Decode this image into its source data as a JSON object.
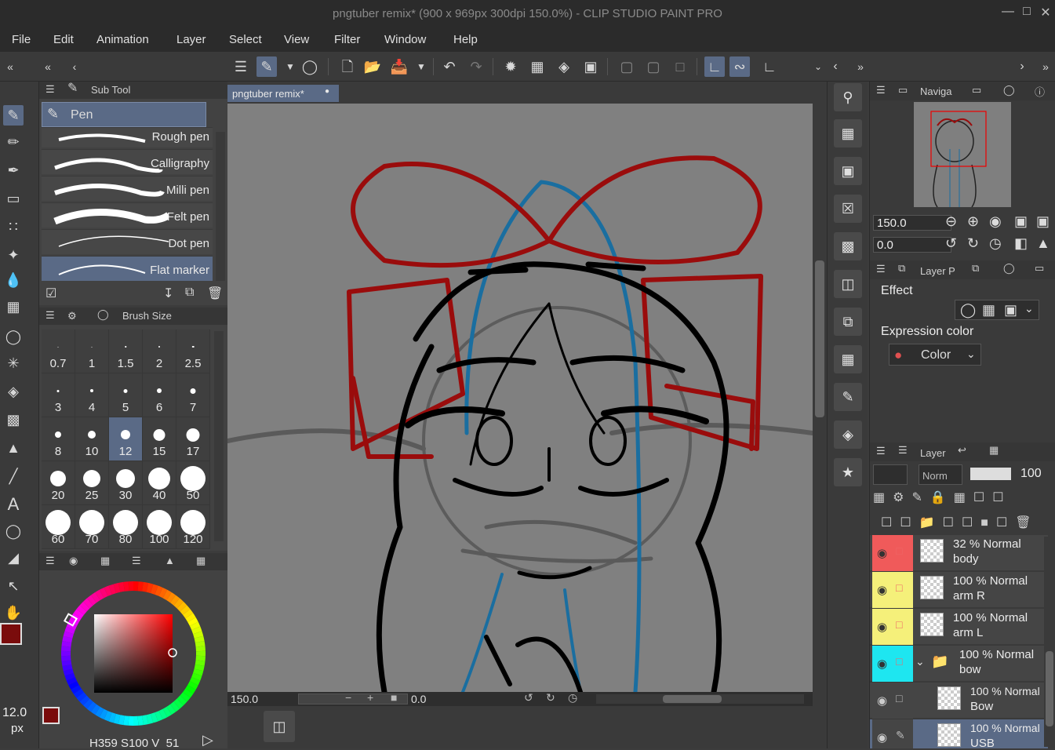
{
  "window": {
    "title": "pngtuber remix* (900 x 969px 300dpi 150.0%)  - CLIP STUDIO PAINT PRO"
  },
  "menu": [
    "File",
    "Edit",
    "Animation",
    "Layer",
    "Select",
    "View",
    "Filter",
    "Window",
    "Help"
  ],
  "subtool": {
    "panel_title": "Sub Tool",
    "group": "Pen",
    "brushes": [
      {
        "label": "Rough pen",
        "selected": false
      },
      {
        "label": "Calligraphy",
        "selected": false
      },
      {
        "label": "Milli pen",
        "selected": false
      },
      {
        "label": "Felt pen",
        "selected": false
      },
      {
        "label": "Dot pen",
        "selected": false
      },
      {
        "label": "Flat marker",
        "selected": true
      }
    ]
  },
  "brush_size": {
    "panel_title": "Brush Size",
    "sizes": [
      "0.7",
      "1",
      "1.5",
      "2",
      "2.5",
      "3",
      "4",
      "5",
      "6",
      "7",
      "8",
      "10",
      "12",
      "15",
      "17",
      "20",
      "25",
      "30",
      "40",
      "50",
      "60",
      "70",
      "80",
      "100",
      "120"
    ],
    "selected": "12",
    "current_value": "12.0",
    "unit": "px"
  },
  "color": {
    "main": "#7a0c0c",
    "sub": "#ffffff",
    "hue": 359,
    "saturation": 100,
    "value": 51,
    "h_label": "H",
    "s_label": "S",
    "v_label": "V"
  },
  "canvas": {
    "tab_label": "pngtuber remix*",
    "zoom": "150.0",
    "angle": "0.0"
  },
  "navigator": {
    "title": "Naviga",
    "zoom": "150.0",
    "angle": "0.0"
  },
  "layer_property": {
    "title": "Layer P",
    "effect_label": "Effect",
    "expression_color_label": "Expression color",
    "color_mode": "Color"
  },
  "layer_panel": {
    "title": "Layer",
    "blend_mode": "Norm",
    "opacity": "100",
    "layers": [
      {
        "opacity_blend": "32 % Normal",
        "name": "body",
        "color": "#f05a5a",
        "folder": false,
        "selected": false,
        "indent": false
      },
      {
        "opacity_blend": "100 % Normal",
        "name": "arm R",
        "color": "#f5f07a",
        "folder": false,
        "selected": false,
        "indent": false
      },
      {
        "opacity_blend": "100 % Normal",
        "name": "arm L",
        "color": "#f5f07a",
        "folder": false,
        "selected": false,
        "indent": false
      },
      {
        "opacity_blend": "100 % Normal",
        "name": "bow",
        "color": "#1ee6f0",
        "folder": true,
        "selected": false,
        "indent": false
      },
      {
        "opacity_blend": "100 % Normal",
        "name": "Bow",
        "color": "#454545",
        "folder": false,
        "selected": false,
        "indent": true
      },
      {
        "opacity_blend": "100 % Normal",
        "name": "USB",
        "color": "#454545",
        "folder": false,
        "selected": true,
        "indent": true
      }
    ]
  }
}
